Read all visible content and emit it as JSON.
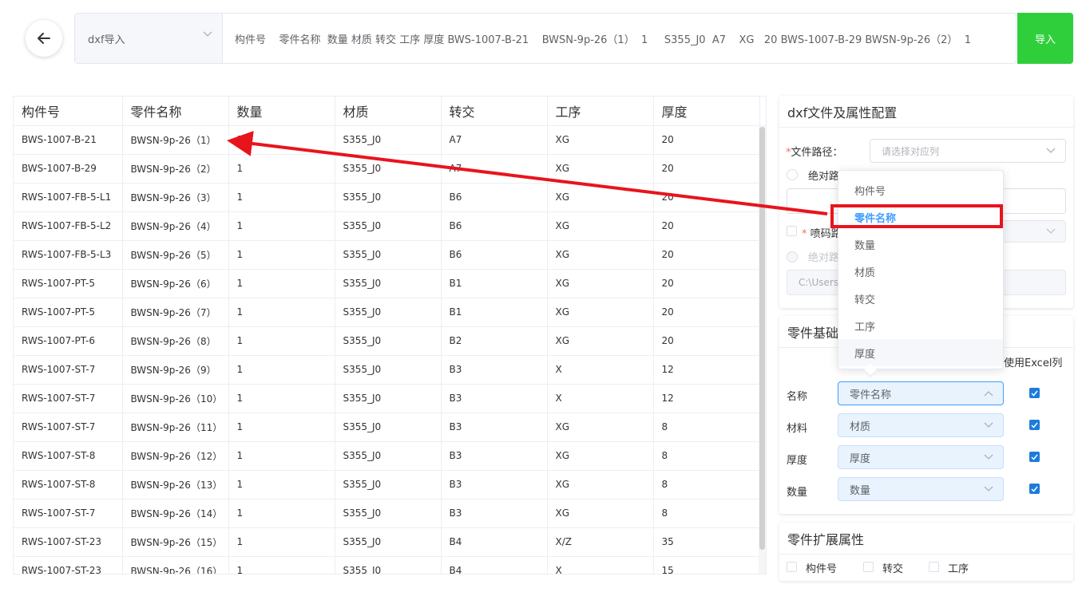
{
  "topbar": {
    "mode_select": "dxf导入",
    "paste_text": "构件号    零件名称  数量 材质 转交 工序 厚度 BWS-1007-B-21    BWSN-9p-26（1）  1     S355_J0  A7    XG   20 BWS-1007-B-29 BWSN-9p-26（2）  1",
    "import_label": "导入"
  },
  "table": {
    "columns": [
      "构件号",
      "零件名称",
      "数量",
      "材质",
      "转交",
      "工序",
      "厚度"
    ],
    "rows": [
      [
        "BWS-1007-B-21",
        "BWSN-9p-26（1）",
        "1",
        "S355_J0",
        "A7",
        "XG",
        "20"
      ],
      [
        "BWS-1007-B-29",
        "BWSN-9p-26（2）",
        "1",
        "S355_J0",
        "A7",
        "XG",
        "20"
      ],
      [
        "RWS-1007-FB-5-L1",
        "BWSN-9p-26（3）",
        "1",
        "S355_J0",
        "B6",
        "XG",
        "20"
      ],
      [
        "RWS-1007-FB-5-L2",
        "BWSN-9p-26（4）",
        "1",
        "S355_J0",
        "B6",
        "XG",
        "20"
      ],
      [
        "RWS-1007-FB-5-L3",
        "BWSN-9p-26（5）",
        "1",
        "S355_J0",
        "B6",
        "XG",
        "20"
      ],
      [
        "RWS-1007-PT-5",
        "BWSN-9p-26（6）",
        "1",
        "S355_J0",
        "B1",
        "XG",
        "20"
      ],
      [
        "RWS-1007-PT-5",
        "BWSN-9p-26（7）",
        "1",
        "S355_J0",
        "B1",
        "XG",
        "20"
      ],
      [
        "RWS-1007-PT-6",
        "BWSN-9p-26（8）",
        "1",
        "S355_J0",
        "B2",
        "XG",
        "20"
      ],
      [
        "RWS-1007-ST-7",
        "BWSN-9p-26（9）",
        "1",
        "S355_J0",
        "B3",
        "X",
        "12"
      ],
      [
        "RWS-1007-ST-7",
        "BWSN-9p-26（10）",
        "1",
        "S355_J0",
        "B3",
        "X",
        "12"
      ],
      [
        "RWS-1007-ST-7",
        "BWSN-9p-26（11）",
        "1",
        "S355_J0",
        "B3",
        "XG",
        "8"
      ],
      [
        "RWS-1007-ST-8",
        "BWSN-9p-26（12）",
        "1",
        "S355_J0",
        "B3",
        "XG",
        "8"
      ],
      [
        "RWS-1007-ST-8",
        "BWSN-9p-26（13）",
        "1",
        "S355_J0",
        "B3",
        "XG",
        "8"
      ],
      [
        "RWS-1007-ST-7",
        "BWSN-9p-26（14）",
        "1",
        "S355_J0",
        "B3",
        "XG",
        "8"
      ],
      [
        "RWS-1007-ST-23",
        "BWSN-9p-26（15）",
        "1",
        "S355_J0",
        "B4",
        "X/Z",
        "35"
      ],
      [
        "RWS-1007-ST-23",
        "BWSN-9p-26（16）",
        "1",
        "S355_J0",
        "B4",
        "X",
        "15"
      ]
    ]
  },
  "config_panel": {
    "title": "dxf文件及属性配置",
    "file_path_label": "文件路径：",
    "file_path_placeholder": "请选择对应列",
    "absolute_label_1": "绝对路",
    "spray_label": "喷码路",
    "absolute_label_2": "绝对路",
    "path_value": "C:\\Users"
  },
  "dropdown": {
    "options": [
      "构件号",
      "零件名称",
      "数量",
      "材质",
      "转交",
      "工序",
      "厚度"
    ],
    "selected": "零件名称"
  },
  "basic_panel": {
    "title": "零件基础",
    "use_excel_label": "使用Excel列",
    "fields": [
      {
        "label": "名称",
        "value": "零件名称"
      },
      {
        "label": "材料",
        "value": "材质"
      },
      {
        "label": "厚度",
        "value": "厚度"
      },
      {
        "label": "数量",
        "value": "数量"
      }
    ]
  },
  "ext_panel": {
    "title": "零件扩展属性",
    "options": [
      "构件号",
      "转交",
      "工序"
    ]
  },
  "colors": {
    "import_green": "#2fcf3c",
    "annotation_red": "#e8141c",
    "selected_blue": "#409eff",
    "checkbox_blue": "#1e7bdc"
  }
}
